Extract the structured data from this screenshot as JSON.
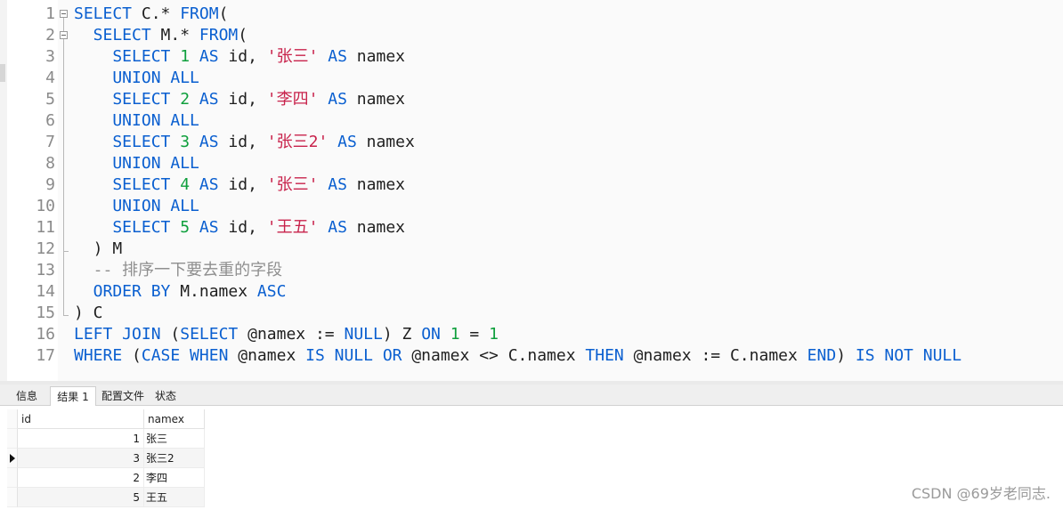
{
  "editor": {
    "line_numbers": [
      "1",
      "2",
      "3",
      "4",
      "5",
      "6",
      "7",
      "8",
      "9",
      "10",
      "11",
      "12",
      "13",
      "14",
      "15",
      "16",
      "17"
    ],
    "lines": [
      [
        {
          "t": "SELECT",
          "c": "kw"
        },
        {
          "t": " C.* ",
          "c": "pl"
        },
        {
          "t": "FROM",
          "c": "kw"
        },
        {
          "t": "(",
          "c": "pl"
        }
      ],
      [
        {
          "t": "  SELECT",
          "c": "kw"
        },
        {
          "t": " M.* ",
          "c": "pl"
        },
        {
          "t": "FROM",
          "c": "kw"
        },
        {
          "t": "(",
          "c": "pl"
        }
      ],
      [
        {
          "t": "    SELECT ",
          "c": "kw"
        },
        {
          "t": "1",
          "c": "num"
        },
        {
          "t": " AS",
          "c": "kw"
        },
        {
          "t": " id, ",
          "c": "pl"
        },
        {
          "t": "'张三'",
          "c": "str"
        },
        {
          "t": " AS",
          "c": "kw"
        },
        {
          "t": " namex",
          "c": "pl"
        }
      ],
      [
        {
          "t": "    UNION ALL",
          "c": "kw"
        }
      ],
      [
        {
          "t": "    SELECT ",
          "c": "kw"
        },
        {
          "t": "2",
          "c": "num"
        },
        {
          "t": " AS",
          "c": "kw"
        },
        {
          "t": " id, ",
          "c": "pl"
        },
        {
          "t": "'李四'",
          "c": "str"
        },
        {
          "t": " AS",
          "c": "kw"
        },
        {
          "t": " namex",
          "c": "pl"
        }
      ],
      [
        {
          "t": "    UNION ALL",
          "c": "kw"
        }
      ],
      [
        {
          "t": "    SELECT ",
          "c": "kw"
        },
        {
          "t": "3",
          "c": "num"
        },
        {
          "t": " AS",
          "c": "kw"
        },
        {
          "t": " id, ",
          "c": "pl"
        },
        {
          "t": "'张三2'",
          "c": "str"
        },
        {
          "t": " AS",
          "c": "kw"
        },
        {
          "t": " namex",
          "c": "pl"
        }
      ],
      [
        {
          "t": "    UNION ALL",
          "c": "kw"
        }
      ],
      [
        {
          "t": "    SELECT ",
          "c": "kw"
        },
        {
          "t": "4",
          "c": "num"
        },
        {
          "t": " AS",
          "c": "kw"
        },
        {
          "t": " id, ",
          "c": "pl"
        },
        {
          "t": "'张三'",
          "c": "str"
        },
        {
          "t": " AS",
          "c": "kw"
        },
        {
          "t": " namex",
          "c": "pl"
        }
      ],
      [
        {
          "t": "    UNION ALL",
          "c": "kw"
        }
      ],
      [
        {
          "t": "    SELECT ",
          "c": "kw"
        },
        {
          "t": "5",
          "c": "num"
        },
        {
          "t": " AS",
          "c": "kw"
        },
        {
          "t": " id, ",
          "c": "pl"
        },
        {
          "t": "'王五'",
          "c": "str"
        },
        {
          "t": " AS",
          "c": "kw"
        },
        {
          "t": " namex",
          "c": "pl"
        }
      ],
      [
        {
          "t": "  ) M",
          "c": "pl"
        }
      ],
      [
        {
          "t": "  -- 排序一下要去重的字段",
          "c": "cmt"
        }
      ],
      [
        {
          "t": "  ORDER BY",
          "c": "kw"
        },
        {
          "t": " M.namex ",
          "c": "pl"
        },
        {
          "t": "ASC",
          "c": "kw"
        }
      ],
      [
        {
          "t": ") C",
          "c": "pl"
        }
      ],
      [
        {
          "t": "LEFT JOIN",
          "c": "kw"
        },
        {
          "t": " (",
          "c": "pl"
        },
        {
          "t": "SELECT",
          "c": "kw"
        },
        {
          "t": " @namex := ",
          "c": "pl"
        },
        {
          "t": "NULL",
          "c": "kw"
        },
        {
          "t": ") Z ",
          "c": "pl"
        },
        {
          "t": "ON",
          "c": "kw"
        },
        {
          "t": " ",
          "c": "pl"
        },
        {
          "t": "1",
          "c": "num"
        },
        {
          "t": " = ",
          "c": "pl"
        },
        {
          "t": "1",
          "c": "num"
        }
      ],
      [
        {
          "t": "WHERE",
          "c": "kw"
        },
        {
          "t": " (",
          "c": "pl"
        },
        {
          "t": "CASE WHEN",
          "c": "kw"
        },
        {
          "t": " @namex ",
          "c": "pl"
        },
        {
          "t": "IS NULL OR",
          "c": "kw"
        },
        {
          "t": " @namex <> C.namex ",
          "c": "pl"
        },
        {
          "t": "THEN",
          "c": "kw"
        },
        {
          "t": " @namex := C.namex ",
          "c": "pl"
        },
        {
          "t": "END",
          "c": "kw"
        },
        {
          "t": ") ",
          "c": "pl"
        },
        {
          "t": "IS NOT NULL",
          "c": "kw"
        }
      ]
    ]
  },
  "tabs": [
    {
      "label": "信息",
      "active": false
    },
    {
      "label": "结果 1",
      "active": true
    },
    {
      "label": "配置文件",
      "active": false
    },
    {
      "label": "状态",
      "active": false
    }
  ],
  "results": {
    "columns": [
      "id",
      "namex"
    ],
    "rows": [
      {
        "id": "1",
        "namex": "张三"
      },
      {
        "id": "3",
        "namex": "张三2"
      },
      {
        "id": "2",
        "namex": "李四"
      },
      {
        "id": "5",
        "namex": "王五"
      }
    ],
    "current_row": 1
  },
  "watermark": "CSDN @69岁老同志."
}
